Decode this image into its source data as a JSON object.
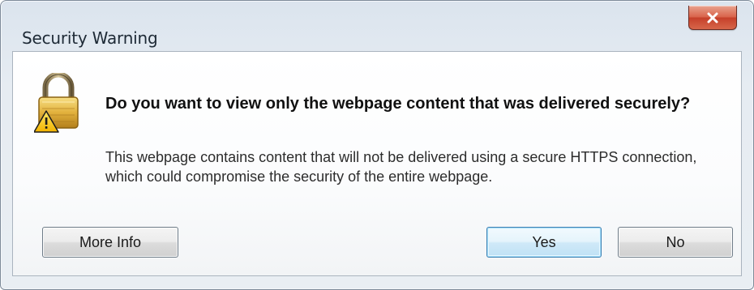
{
  "window": {
    "title": "Security Warning",
    "close_label": "X"
  },
  "message": {
    "heading": "Do you want to view only the webpage content that was delivered securely?",
    "body": "This webpage contains content that will not be delivered using a secure HTTPS connection, which could compromise the security of the entire webpage."
  },
  "buttons": {
    "more_info": "More Info",
    "yes": "Yes",
    "no": "No"
  },
  "icons": {
    "warning": "lock-warning-icon",
    "close": "close-icon"
  },
  "colors": {
    "close_button": "#d24a34",
    "default_button_border": "#3c7fb1"
  }
}
